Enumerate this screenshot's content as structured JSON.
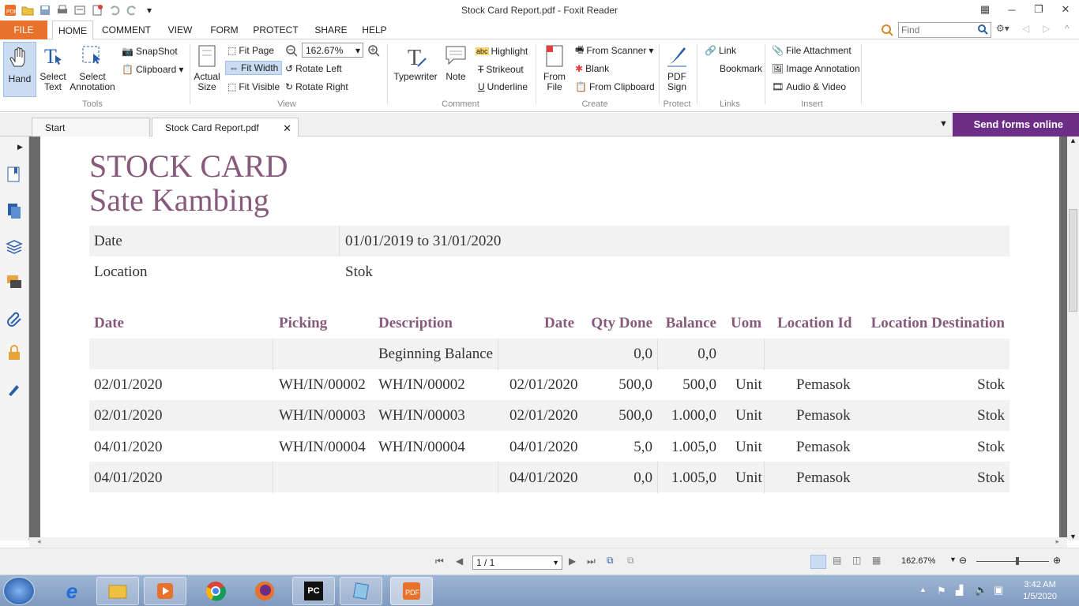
{
  "window": {
    "title": "Stock Card Report.pdf - Foxit Reader"
  },
  "menu": {
    "file": "FILE",
    "tabs": [
      "HOME",
      "COMMENT",
      "VIEW",
      "FORM",
      "PROTECT",
      "SHARE",
      "HELP"
    ],
    "find_placeholder": "Find"
  },
  "ribbon": {
    "tools": {
      "hand": "Hand",
      "select_text": "Select Text",
      "select_annotation": "Select Annotation",
      "snapshot": "SnapShot",
      "clipboard": "Clipboard",
      "group": "Tools"
    },
    "view": {
      "actual_size": "Actual Size",
      "fit_page": "Fit Page",
      "fit_width": "Fit Width",
      "fit_visible": "Fit Visible",
      "zoom": "162.67%",
      "rotate_left": "Rotate Left",
      "rotate_right": "Rotate Right",
      "group": "View"
    },
    "comment": {
      "typewriter": "Typewriter",
      "note": "Note",
      "highlight": "Highlight",
      "strikeout": "Strikeout",
      "underline": "Underline",
      "group": "Comment"
    },
    "create": {
      "from_file": "From File",
      "from_scanner": "From Scanner",
      "blank": "Blank",
      "from_clipboard": "From Clipboard",
      "group": "Create"
    },
    "protect": {
      "pdf_sign": "PDF Sign",
      "group": "Protect"
    },
    "links": {
      "link": "Link",
      "bookmark": "Bookmark",
      "group": "Links"
    },
    "insert": {
      "file_attachment": "File Attachment",
      "image_annotation": "Image Annotation",
      "audio_video": "Audio & Video",
      "group": "Insert"
    }
  },
  "doc_tabs": {
    "start": "Start",
    "active": "Stock Card Report.pdf",
    "send_forms": "Send forms online"
  },
  "report": {
    "title": "STOCK CARD",
    "subtitle": "Sate Kambing",
    "info": [
      {
        "label": "Date",
        "value": "01/01/2019 to 31/01/2020"
      },
      {
        "label": "Location",
        "value": "Stok"
      }
    ],
    "headers": [
      "Date",
      "Picking",
      "Description",
      "Date",
      "Qty Done",
      "Balance",
      "Uom",
      "Location Id",
      "Location Destination"
    ],
    "rows": [
      {
        "date": "",
        "picking": "",
        "description": "Beginning Balance",
        "date2": "",
        "qty": "0,0",
        "balance": "0,0",
        "uom": "",
        "loc": "",
        "dest": ""
      },
      {
        "date": "02/01/2020",
        "picking": "WH/IN/00002",
        "description": "WH/IN/00002",
        "date2": "02/01/2020",
        "qty": "500,0",
        "balance": "500,0",
        "uom": "Unit",
        "loc": "Pemasok",
        "dest": "Stok"
      },
      {
        "date": "02/01/2020",
        "picking": "WH/IN/00003",
        "description": "WH/IN/00003",
        "date2": "02/01/2020",
        "qty": "500,0",
        "balance": "1.000,0",
        "uom": "Unit",
        "loc": "Pemasok",
        "dest": "Stok"
      },
      {
        "date": "04/01/2020",
        "picking": "WH/IN/00004",
        "description": "WH/IN/00004",
        "date2": "04/01/2020",
        "qty": "5,0",
        "balance": "1.005,0",
        "uom": "Unit",
        "loc": "Pemasok",
        "dest": "Stok"
      },
      {
        "date": "04/01/2020",
        "picking": "",
        "description": "",
        "date2": "04/01/2020",
        "qty": "0,0",
        "balance": "1.005,0",
        "uom": "Unit",
        "loc": "Pemasok",
        "dest": "Stok"
      }
    ]
  },
  "status": {
    "page": "1 / 1",
    "zoom": "162.67%"
  },
  "taskbar": {
    "time": "3:42 AM",
    "date": "1/5/2020"
  },
  "colors": {
    "accent": "#875a7b",
    "file_tab": "#e8712b",
    "send_forms": "#6d2e87"
  }
}
